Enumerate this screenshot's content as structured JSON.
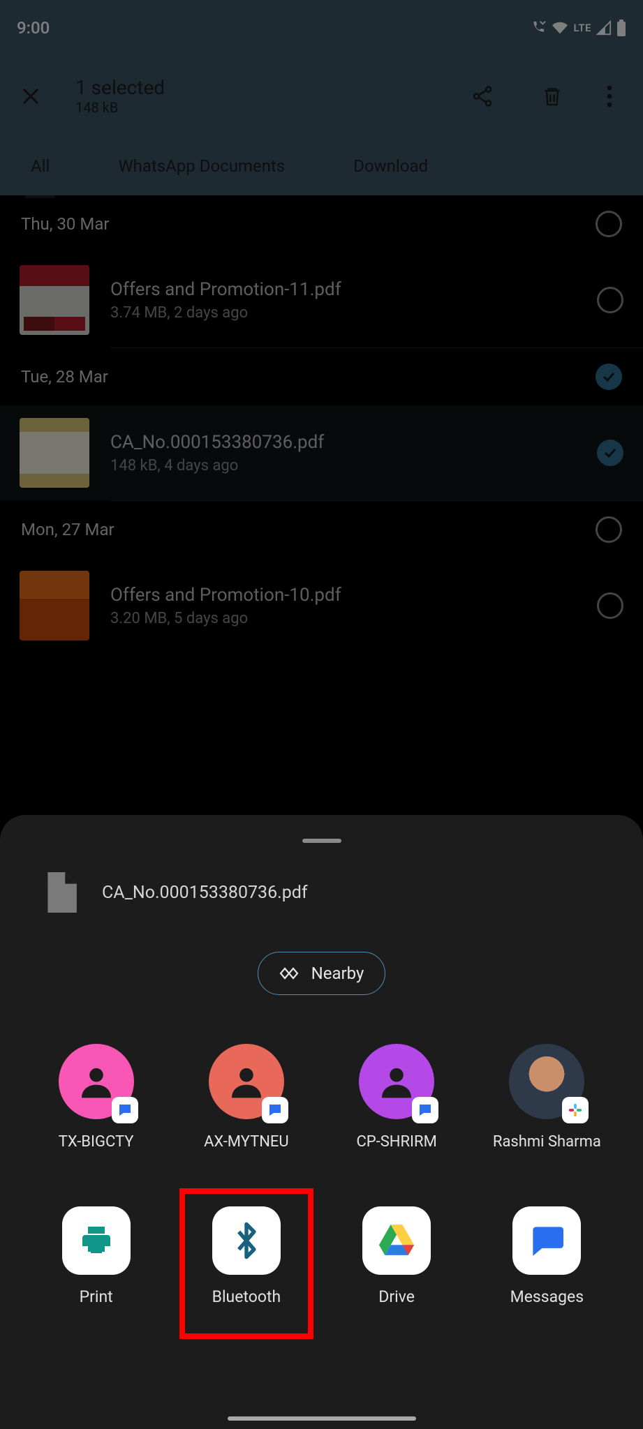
{
  "status": {
    "time": "9:00",
    "network": "LTE"
  },
  "header": {
    "title": "1 selected",
    "subtitle": "148 kB"
  },
  "tabs": [
    "All",
    "WhatsApp Documents",
    "Download"
  ],
  "list": {
    "date1": "Thu, 30 Mar",
    "date2": "Tue, 28 Mar",
    "date3": "Mon, 27 Mar",
    "file1": {
      "name": "Offers and Promotion-11.pdf",
      "meta": "3.74 MB, 2 days ago"
    },
    "file2": {
      "name": "CA_No.000153380736.pdf",
      "meta": "148 kB, 4 days ago"
    },
    "file3": {
      "name": "Offers and Promotion-10.pdf",
      "meta": "3.20 MB, 5 days ago"
    }
  },
  "sheet": {
    "filename": "CA_No.000153380736.pdf",
    "nearby": "Nearby",
    "contacts": [
      "TX-BIGCTY",
      "AX-MYTNEU",
      "CP-SHRIRM",
      "Rashmi Sharma"
    ],
    "apps": [
      "Print",
      "Bluetooth",
      "Drive",
      "Messages"
    ]
  }
}
